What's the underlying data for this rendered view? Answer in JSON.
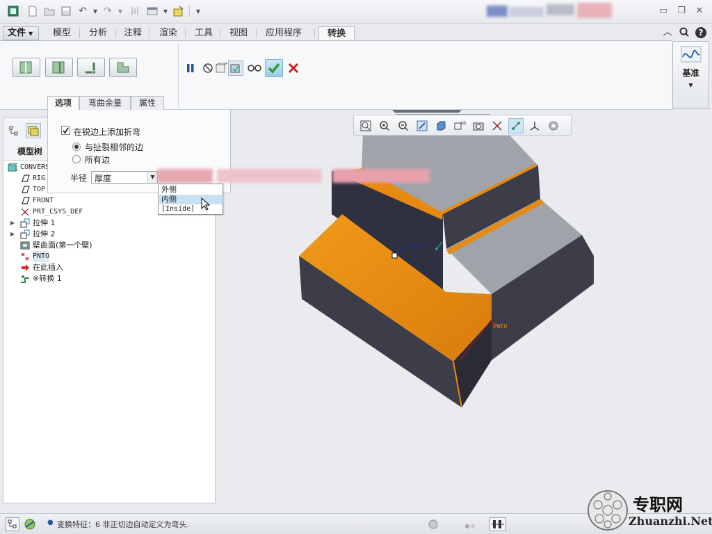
{
  "menu": {
    "file_label": "文件",
    "tabs": [
      "模型",
      "分析",
      "注释",
      "渲染",
      "工具",
      "视图",
      "应用程序"
    ],
    "active_tab": "转换"
  },
  "ribbon": {
    "subtabs": [
      "选项",
      "弯曲余量",
      "属性"
    ],
    "datum_label": "基准"
  },
  "options": {
    "add_bends_label": "在锐边上添加折弯",
    "add_bends_checked": true,
    "radio_adjacent_label": "与扯裂相邻的边",
    "radio_all_label": "所有边",
    "radius_label": "半径",
    "radius_value": "厚度"
  },
  "dropdown": {
    "options": [
      "外侧",
      "内侧",
      "[Inside]"
    ],
    "selected": "内侧"
  },
  "model_tree": {
    "title": "模型树",
    "items": [
      {
        "label": "CONVERS",
        "mono": true,
        "icon": "part-icon",
        "indent": 0
      },
      {
        "label": "RIG",
        "mono": true,
        "icon": "datum-plane-icon",
        "indent": 1
      },
      {
        "label": "TOP",
        "mono": true,
        "icon": "datum-plane-icon",
        "indent": 1
      },
      {
        "label": "FRONT",
        "mono": true,
        "icon": "datum-plane-icon",
        "indent": 1
      },
      {
        "label": "PRT_CSYS_DEF",
        "mono": true,
        "icon": "csys-icon",
        "indent": 1
      },
      {
        "label": "拉伸 1",
        "mono": false,
        "icon": "extrude-icon",
        "indent": 1
      },
      {
        "label": "拉伸 2",
        "mono": false,
        "icon": "extrude-icon",
        "indent": 1
      },
      {
        "label": "壁曲面(第一个壁)",
        "mono": false,
        "icon": "wall-icon",
        "indent": 1
      },
      {
        "label": "PNTO",
        "mono": true,
        "icon": "datum-point-icon",
        "indent": 1
      },
      {
        "label": "在此插入",
        "mono": false,
        "icon": "insert-arrow-icon",
        "indent": 1
      },
      {
        "label": "※转换 1",
        "mono": false,
        "icon": "conversion-icon",
        "indent": 1
      }
    ]
  },
  "graphics": {
    "point_label": "PNTO",
    "orange": "#e68a12",
    "gray_top": "#a0a4aa",
    "dark_side": "#3c3d48"
  },
  "status": {
    "message": "变换特征：6 非正切边自动定义为弯头."
  },
  "watermark": {
    "cn": "专职网",
    "en": "Zhuanzhi.Net"
  }
}
